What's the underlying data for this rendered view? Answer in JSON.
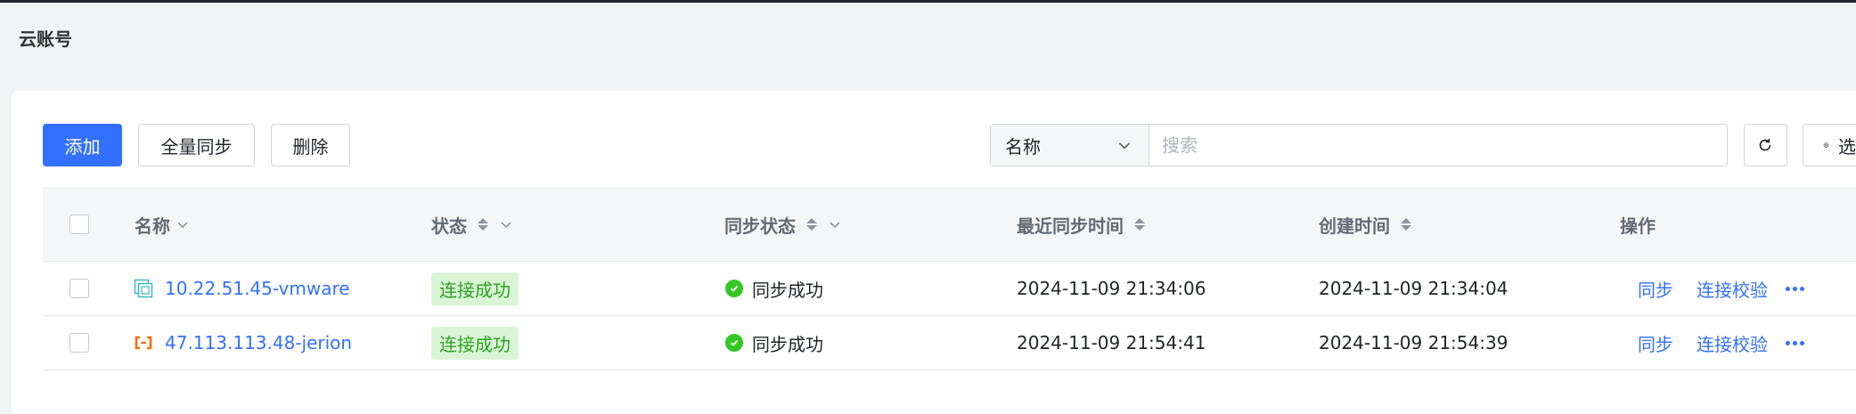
{
  "page": {
    "title": "云账号"
  },
  "toolbar": {
    "add_label": "添加",
    "sync_all_label": "全量同步",
    "delete_label": "删除",
    "filter_field": "名称",
    "search_placeholder": "搜索",
    "settings_label": "选"
  },
  "table": {
    "columns": {
      "name": "名称",
      "status": "状态",
      "sync_status": "同步状态",
      "last_sync": "最近同步时间",
      "created": "创建时间",
      "actions": "操作"
    },
    "rows": [
      {
        "name": "10.22.51.45-vmware",
        "provider_icon": "vmware-icon",
        "status": "连接成功",
        "sync_status": "同步成功",
        "last_sync": "2024-11-09 21:34:06",
        "created": "2024-11-09 21:34:04",
        "action_sync": "同步",
        "action_check": "连接校验"
      },
      {
        "name": "47.113.113.48-jerion",
        "provider_icon": "aliyun-icon",
        "status": "连接成功",
        "sync_status": "同步成功",
        "last_sync": "2024-11-09 21:54:41",
        "created": "2024-11-09 21:54:39",
        "action_sync": "同步",
        "action_check": "连接校验"
      }
    ]
  },
  "colors": {
    "primary": "#3370ff",
    "success_tag_bg": "#d9f5d6",
    "success_tag_text": "#2ea121",
    "success_dot": "#34c724",
    "vmware_icon": "#3eb8c8",
    "aliyun_icon": "#ff6a00"
  }
}
